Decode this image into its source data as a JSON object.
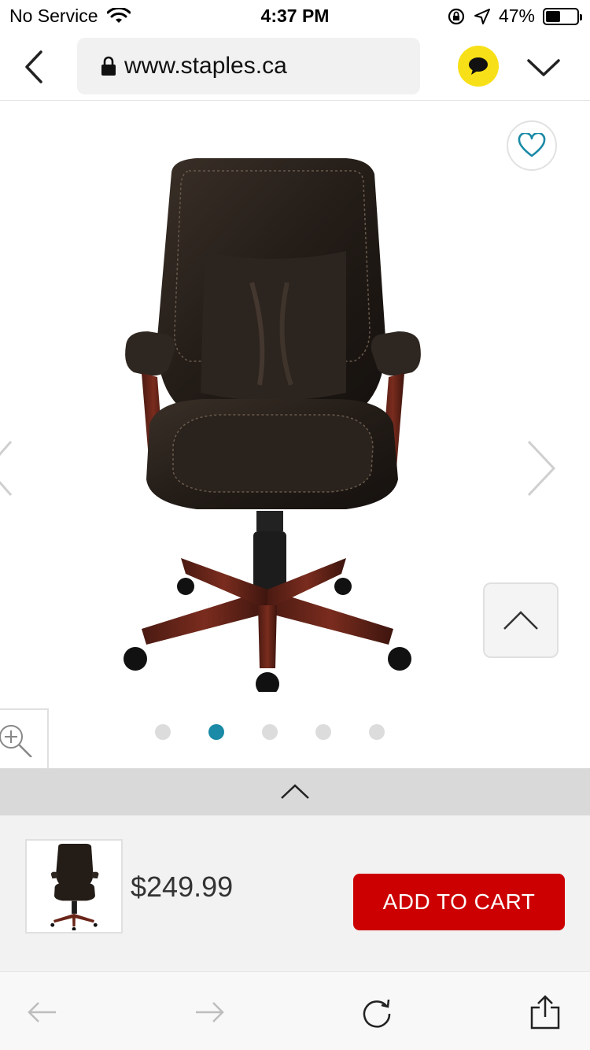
{
  "status_bar": {
    "carrier": "No Service",
    "time": "4:37 PM",
    "battery_percent": "47%",
    "battery_level": 0.47
  },
  "browser": {
    "url": "www.staples.ca"
  },
  "gallery": {
    "image_count": 5,
    "active_index": 1
  },
  "product": {
    "price": "$249.99",
    "add_to_cart_label": "ADD TO CART"
  },
  "colors": {
    "accent": "#1a8aa6",
    "cart_button": "#cc0000",
    "chat_button": "#f7e017"
  },
  "icons": {
    "wifi": "wifi-icon",
    "lock": "lock-icon",
    "heart": "heart-icon",
    "chat": "chat-bubble-icon",
    "zoom": "zoom-in-icon",
    "share": "share-icon",
    "reload": "reload-icon"
  }
}
